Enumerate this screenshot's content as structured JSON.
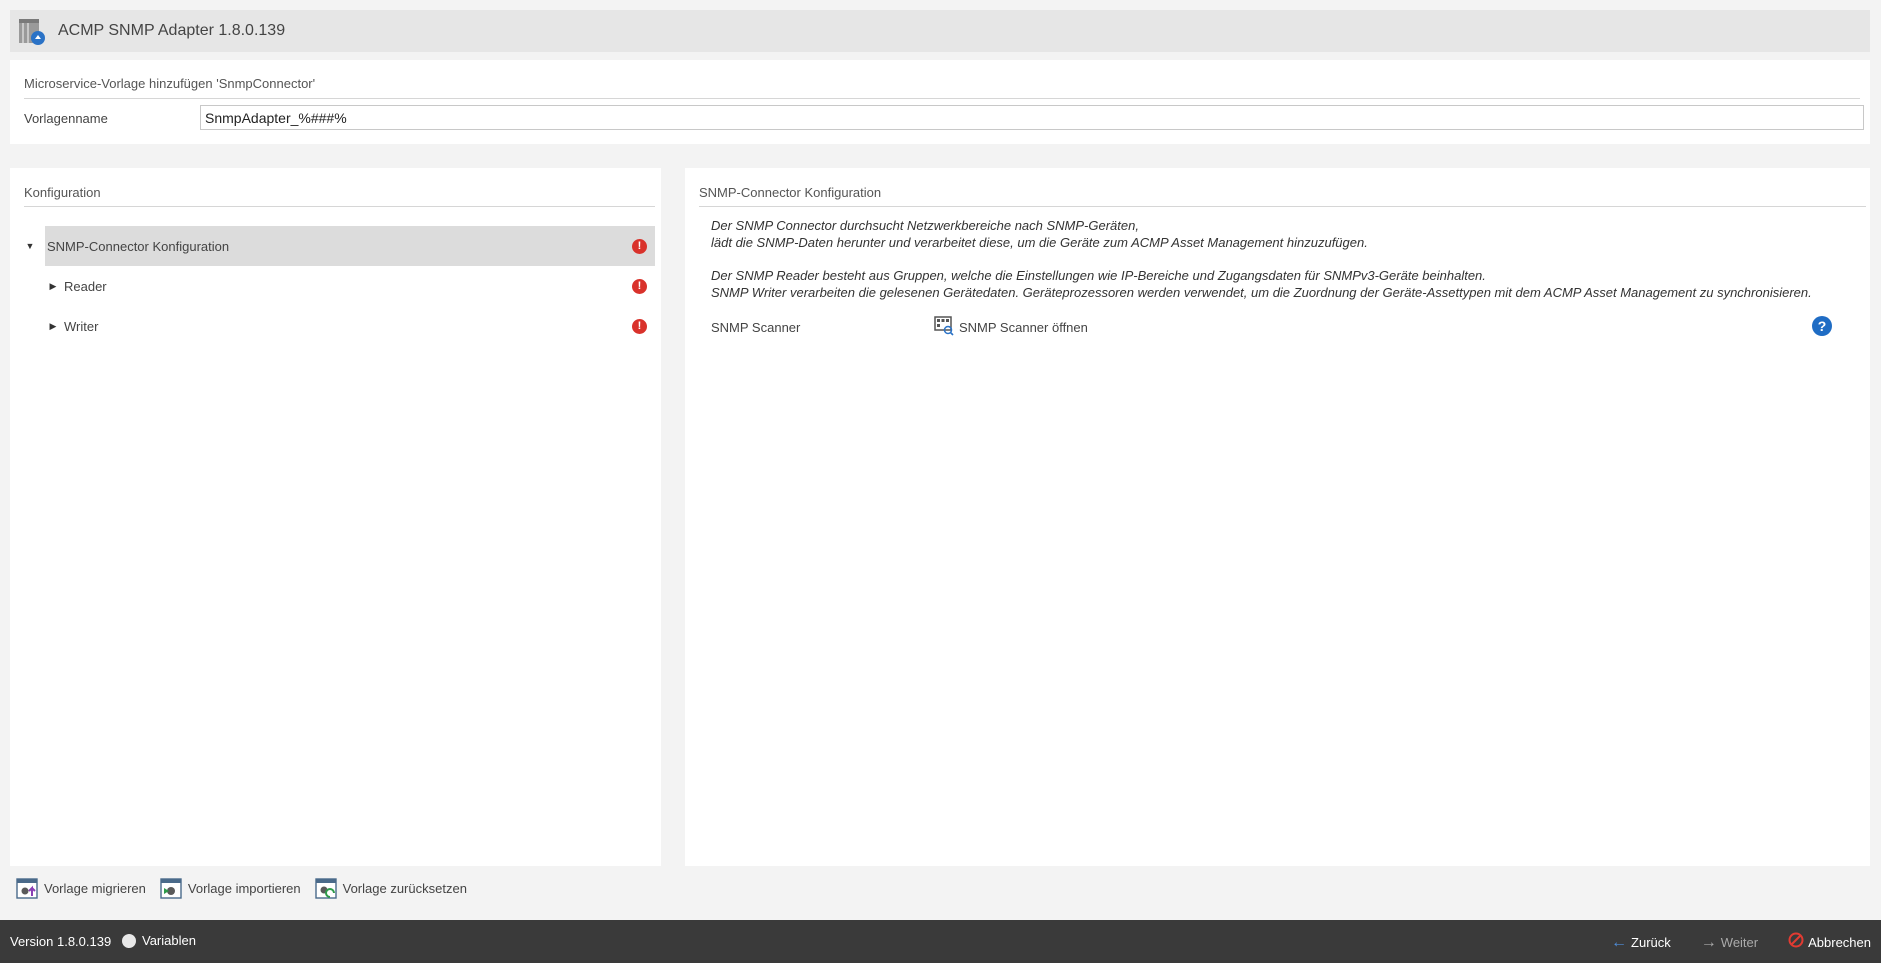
{
  "window": {
    "title": "ACMP SNMP Adapter 1.8.0.139",
    "icon": "app-package-icon"
  },
  "template": {
    "heading": "Microservice-Vorlage hinzufügen 'SnmpConnector'",
    "name_label": "Vorlagenname",
    "name_value": "SnmpAdapter_%###%"
  },
  "config_panel": {
    "heading": "Konfiguration",
    "tree": [
      {
        "label": "SNMP-Connector Konfiguration",
        "expanded": true,
        "selected": true,
        "error": true
      },
      {
        "label": "Reader",
        "expanded": false,
        "error": true
      },
      {
        "label": "Writer",
        "expanded": false,
        "error": true
      }
    ]
  },
  "detail_panel": {
    "heading": "SNMP-Connector Konfiguration",
    "description": [
      "Der SNMP Connector durchsucht Netzwerkbereiche nach SNMP-Geräten,",
      "lädt die SNMP-Daten herunter und verarbeitet diese, um die Geräte zum ACMP Asset Management hinzuzufügen.",
      "Der SNMP Reader besteht aus Gruppen, welche die Einstellungen wie IP-Bereiche und Zugangsdaten für SNMPv3-Geräte beinhalten.",
      "SNMP Writer verarbeiten die gelesenen Gerätedaten. Geräteprozessoren werden verwendet, um die Zuordnung der Geräte-Assettypen mit dem ACMP Asset Management zu synchronisieren."
    ],
    "scanner_label": "SNMP Scanner",
    "scanner_button": "SNMP Scanner öffnen",
    "help_icon_glyph": "?"
  },
  "actions": {
    "migrate": "Vorlage migrieren",
    "import": "Vorlage importieren",
    "reset": "Vorlage zurücksetzen"
  },
  "statusbar": {
    "version": "Version 1.8.0.139",
    "variables": "Variablen",
    "back": "Zurück",
    "next": "Weiter",
    "cancel": "Abbrechen"
  },
  "colors": {
    "error": "#d9322b",
    "help": "#1f6cc4",
    "statusbar": "#3a3a3a",
    "back_arrow": "#4f8fdc",
    "cancel": "#e23b32"
  }
}
